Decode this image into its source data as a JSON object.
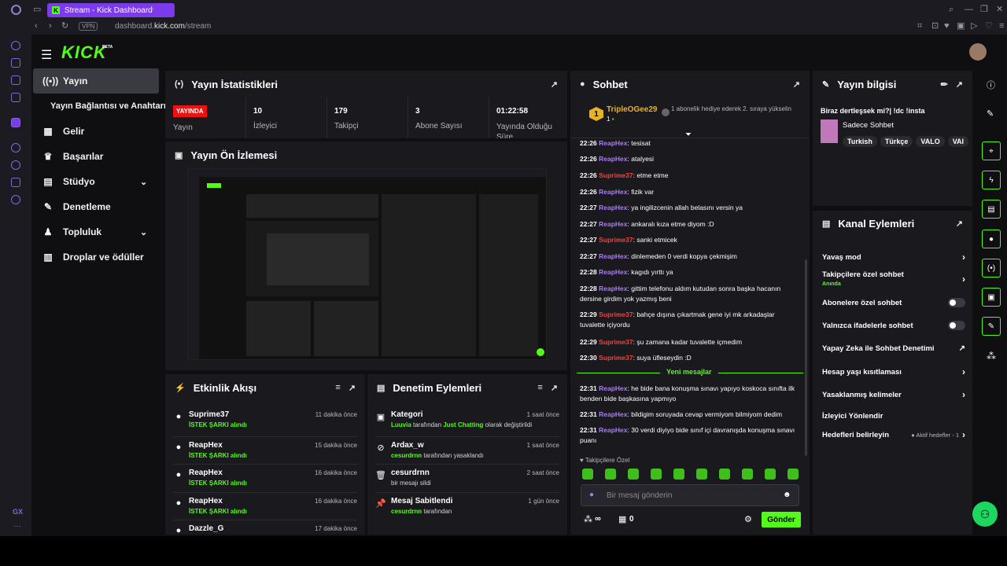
{
  "browser": {
    "tab_title": "Stream - Kick Dashboard",
    "url_prefix": "dashboard.",
    "url_domain": "kick.com",
    "url_path": "/stream",
    "vpn_label": "VPN"
  },
  "header": {
    "logo": "KICK",
    "beta": "BETA"
  },
  "sidebar": {
    "items": [
      {
        "label": "Yayın",
        "icon": "broadcast-icon"
      },
      {
        "label": "Yayın Bağlantısı ve Anahtarı",
        "icon": ""
      },
      {
        "label": "Gelir",
        "icon": "revenue-icon"
      },
      {
        "label": "Başarılar",
        "icon": "trophy-icon"
      },
      {
        "label": "Stüdyo",
        "icon": "studio-icon"
      },
      {
        "label": "Denetleme",
        "icon": "wrench-icon"
      },
      {
        "label": "Topluluk",
        "icon": "community-icon"
      },
      {
        "label": "Droplar ve ödüller",
        "icon": "gift-icon"
      }
    ]
  },
  "stats": {
    "title": "Yayın İstatistikleri",
    "live_badge": "YAYINDA",
    "live_label": "Yayın",
    "viewers_value": "10",
    "viewers_label": "İzleyici",
    "followers_value": "179",
    "followers_label": "Takipçi",
    "subs_value": "3",
    "subs_label": "Abone Sayısı",
    "uptime_value": "01:22:58",
    "uptime_label": "Yayında Olduğu Süre"
  },
  "preview": {
    "title": "Yayın Ön İzlemesi"
  },
  "activity": {
    "title": "Etkinlik Akışı",
    "items": [
      {
        "name": "Suprime37",
        "sub": "İSTEK ŞARKI alındı",
        "time": "11 dakika önce"
      },
      {
        "name": "ReapHex",
        "sub": "İSTEK ŞARKI alındı",
        "time": "15 dakika önce"
      },
      {
        "name": "ReapHex",
        "sub": "İSTEK ŞARKI alındı",
        "time": "16 dakika önce"
      },
      {
        "name": "ReapHex",
        "sub": "İSTEK ŞARKI alındı",
        "time": "16 dakika önce"
      },
      {
        "name": "Dazzle_G",
        "sub": "",
        "time": "17 dakika önce"
      }
    ]
  },
  "moderation": {
    "title": "Denetim Eylemleri",
    "items": [
      {
        "name": "Kategori",
        "user": "Luuvia",
        "mid": " tarafından ",
        "hl": "Just Chatting",
        "end": " olarak değiştirildi",
        "time": "1 saat önce"
      },
      {
        "name": "Ardax_w",
        "user": "cesurdrnn",
        "mid": " tarafından yasaklandı",
        "hl": "",
        "end": "",
        "time": "1 saat önce"
      },
      {
        "name": "cesurdrnn",
        "user": "",
        "mid": "bir mesajı sildi",
        "hl": "",
        "end": "",
        "time": "2 saat önce"
      },
      {
        "name": "Mesaj Sabitlendi",
        "user": "cesurdrnn",
        "mid": " tarafından",
        "hl": "",
        "end": "",
        "time": "1 gün önce"
      }
    ]
  },
  "chat": {
    "title": "Sohbet",
    "top_user": "TripleOGee29",
    "top_rank": "1",
    "top_count": "1",
    "gift_text": "1 abonelik hediye ederek 2. sıraya yükselin",
    "messages": [
      {
        "time": "22:26",
        "user": "ReapHex",
        "text": "tesisat",
        "color": "purple"
      },
      {
        "time": "22:26",
        "user": "ReapHex",
        "text": "atalyesi",
        "color": "purple"
      },
      {
        "time": "22:26",
        "user": "Suprime37",
        "text": "etme etme",
        "color": "red"
      },
      {
        "time": "22:26",
        "user": "ReapHex",
        "text": "fizik var",
        "color": "purple"
      },
      {
        "time": "22:27",
        "user": "ReapHex",
        "text": "ya ingilizcenin allah belasını versin ya",
        "color": "purple"
      },
      {
        "time": "22:27",
        "user": "ReapHex",
        "text": "ankaralı kıza etme diyom :D",
        "color": "purple"
      },
      {
        "time": "22:27",
        "user": "Suprime37",
        "text": "sanki etmicek",
        "color": "red"
      },
      {
        "time": "22:27",
        "user": "ReapHex",
        "text": "dinlemeden 0 verdi kopya çekmişim",
        "color": "purple"
      },
      {
        "time": "22:28",
        "user": "ReapHex",
        "text": "kagıdı yırttı ya",
        "color": "purple"
      },
      {
        "time": "22:28",
        "user": "ReapHex",
        "text": "gittim telefonu aldım kutudan sonra başka hacanın dersine girdim yok yazmış beni",
        "color": "purple"
      },
      {
        "time": "22:29",
        "user": "Suprime37",
        "text": "bahçe dışına çıkartmak gene iyi mk arkadaşlar tuvalette içiyordu",
        "color": "red"
      },
      {
        "time": "22:29",
        "user": "Suprime37",
        "text": "şu zamana kadar tuvalette içmedim",
        "color": "red"
      },
      {
        "time": "22:30",
        "user": "Suprime37",
        "text": "suya üfleseydin :D",
        "color": "red"
      }
    ],
    "new_messages_label": "Yeni mesajlar",
    "new_messages": [
      {
        "time": "22:31",
        "user": "ReapHex",
        "text": "he bide bana konuşma sınavı yapıyo koskoca sınıfta ilk benden bide başkasına yapmıyo",
        "color": "purple"
      },
      {
        "time": "22:31",
        "user": "ReapHex",
        "text": "bildigim soruyada cevap vermiyom bilmiyom dedim",
        "color": "purple"
      },
      {
        "time": "22:31",
        "user": "ReapHex",
        "text": "30 verdi diyiyo bide sınıf içi davranışda konuşma sınavı puanı",
        "color": "purple"
      }
    ],
    "followers_only": "Takipçilere Özel",
    "input_placeholder": "Bir mesaj gönderin",
    "points_count": "0",
    "send_label": "Gönder",
    "infinity": "∞"
  },
  "stream_info": {
    "title": "Yayın bilgisi",
    "stream_title": "Biraz dertleşsek mi?| !dc !insta",
    "category": "Sadece Sohbet",
    "tags": [
      "Turkish",
      "Türkçe",
      "VALO",
      "VAI"
    ]
  },
  "channel_actions": {
    "title": "Kanal Eylemleri",
    "items": [
      {
        "label": "Yavaş mod",
        "sub": "",
        "ctrl": "chevron"
      },
      {
        "label": "Takipçilere özel sohbet",
        "sub": "Anında",
        "ctrl": "chevron"
      },
      {
        "label": "Abonelere özel sohbet",
        "sub": "",
        "ctrl": "toggle"
      },
      {
        "label": "Yalnızca ifadelerle sohbet",
        "sub": "",
        "ctrl": "toggle"
      },
      {
        "label": "Yapay Zeka ile Sohbet Denetimi",
        "sub": "",
        "ctrl": "external"
      },
      {
        "label": "Hesap yaşı kısıtlaması",
        "sub": "",
        "ctrl": "chevron"
      },
      {
        "label": "Yasaklanmış kelimeler",
        "sub": "",
        "ctrl": "chevron"
      },
      {
        "label": "İzleyici Yönlendir",
        "sub": "",
        "ctrl": "none"
      },
      {
        "label": "Hedefleri belirleyin",
        "sub": "Aktif hedefler - 1",
        "ctrl": "chevron"
      }
    ]
  },
  "colors": {
    "accent": "#53fc18",
    "panel": "#1a1a1e",
    "bg": "#0f0f11",
    "purple": "#a77cf0",
    "red": "#e44444",
    "opera": "#7c3aed"
  }
}
